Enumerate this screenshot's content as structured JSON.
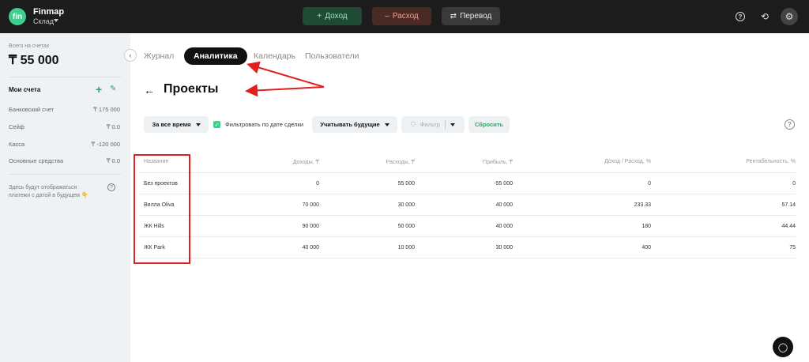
{
  "app": {
    "name": "Finmap",
    "logo_text": "fin",
    "workspace": "Склад"
  },
  "top_actions": {
    "income": "Доход",
    "expense": "Расход",
    "transfer": "Перевод"
  },
  "sidebar": {
    "total_label": "Всего на счетах",
    "total_value": "₸ 55 000",
    "accounts_title": "Мои счета",
    "accounts": [
      {
        "name": "Банковский счет",
        "value": "₸ 175 000"
      },
      {
        "name": "Сейф",
        "value": "₸ 0.0"
      },
      {
        "name": "Касса",
        "value": "₸ -120 000"
      },
      {
        "name": "Основные средства",
        "value": "₸ 0.0"
      }
    ],
    "future_note": "Здесь будут отображаться платежи с датой в будущем 👇"
  },
  "tabs": [
    {
      "label": "Журнал",
      "active": false
    },
    {
      "label": "Аналитика",
      "active": true
    },
    {
      "label": "Календарь",
      "active": false
    },
    {
      "label": "Пользователи",
      "active": false
    }
  ],
  "page": {
    "title": "Проекты"
  },
  "filters": {
    "period": "За все время",
    "filter_by_deal_date": "Фильтровать по дате сделки",
    "consider_future": "Учитывать будущие",
    "filter": "Фильтр",
    "reset": "Сбросить"
  },
  "table": {
    "headers": [
      "Название",
      "Доходы, ₸",
      "Расходы, ₸",
      "Прибыль, ₸",
      "Доход / Расход, %",
      "Рентабельность, %"
    ],
    "rows": [
      [
        "Без проектов",
        "0",
        "55 000",
        "-55 000",
        "0",
        "0"
      ],
      [
        "Вилла Oliva",
        "70 000",
        "30 000",
        "40 000",
        "233.33",
        "57.14"
      ],
      [
        "ЖК Hills",
        "90 000",
        "50 000",
        "40 000",
        "180",
        "44.44"
      ],
      [
        "ЖК Park",
        "40 000",
        "10 000",
        "30 000",
        "400",
        "75"
      ]
    ]
  },
  "colors": {
    "accent": "#3ecf8e",
    "annotation": "#e02020",
    "topbar": "#1c1c1c"
  }
}
